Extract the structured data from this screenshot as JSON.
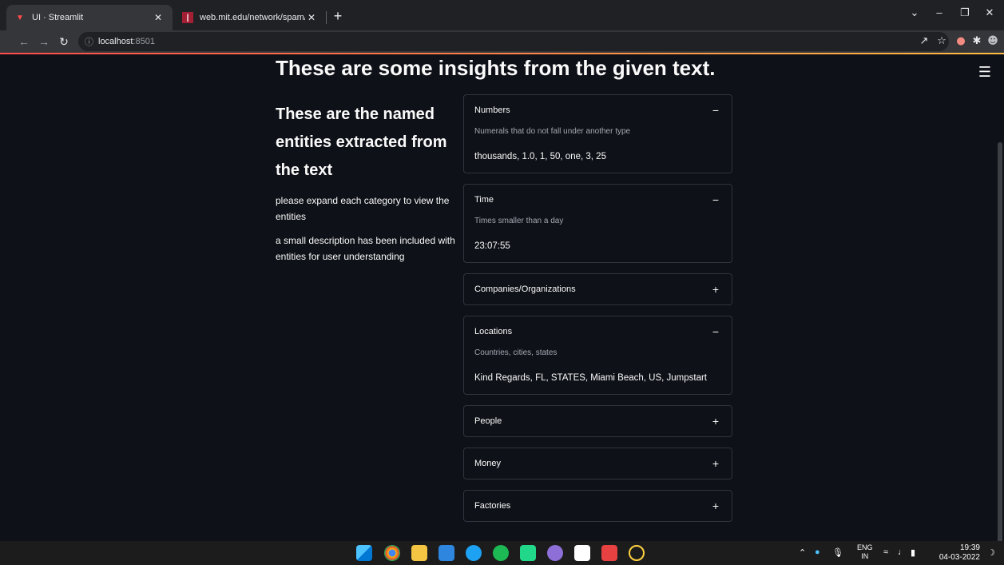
{
  "browser": {
    "tabs": [
      {
        "title": "UI · Streamlit",
        "active": true,
        "favicon": "streamlit-icon"
      },
      {
        "title": "web.mit.edu/network/spam/exam",
        "active": false,
        "favicon": "mit-icon"
      }
    ],
    "url_host": "localhost",
    "url_port": ":8501"
  },
  "page": {
    "title": "These are some insights from the given text.",
    "subtitle": "These are the named entities extracted from the text",
    "paragraphs": [
      "please expand each category to view the entities",
      "a small description has been included with entities for user understanding"
    ]
  },
  "expanders": [
    {
      "label": "Numbers",
      "expanded": true,
      "toggle": "−",
      "description": "Numerals that do not fall under another type",
      "values": "thousands, 1.0, 1, 50, one, 3, 25"
    },
    {
      "label": "Time",
      "expanded": true,
      "toggle": "−",
      "description": "Times smaller than a day",
      "values": "23:07:55"
    },
    {
      "label": "Companies/Organizations",
      "expanded": false,
      "toggle": "+"
    },
    {
      "label": "Locations",
      "expanded": true,
      "toggle": "−",
      "description": "Countries, cities, states",
      "values": "Kind Regards, FL, STATES, Miami Beach, US, Jumpstart"
    },
    {
      "label": "People",
      "expanded": false,
      "toggle": "+"
    },
    {
      "label": "Money",
      "expanded": false,
      "toggle": "+"
    },
    {
      "label": "Factories",
      "expanded": false,
      "toggle": "+"
    }
  ],
  "taskbar": {
    "lang_top": "ENG",
    "lang_bottom": "IN",
    "time": "19:39",
    "date": "04-03-2022"
  },
  "colors": {
    "background": "#0e1117",
    "text": "#fafafa",
    "border": "#31333f",
    "accent": "#ff4b4b"
  }
}
